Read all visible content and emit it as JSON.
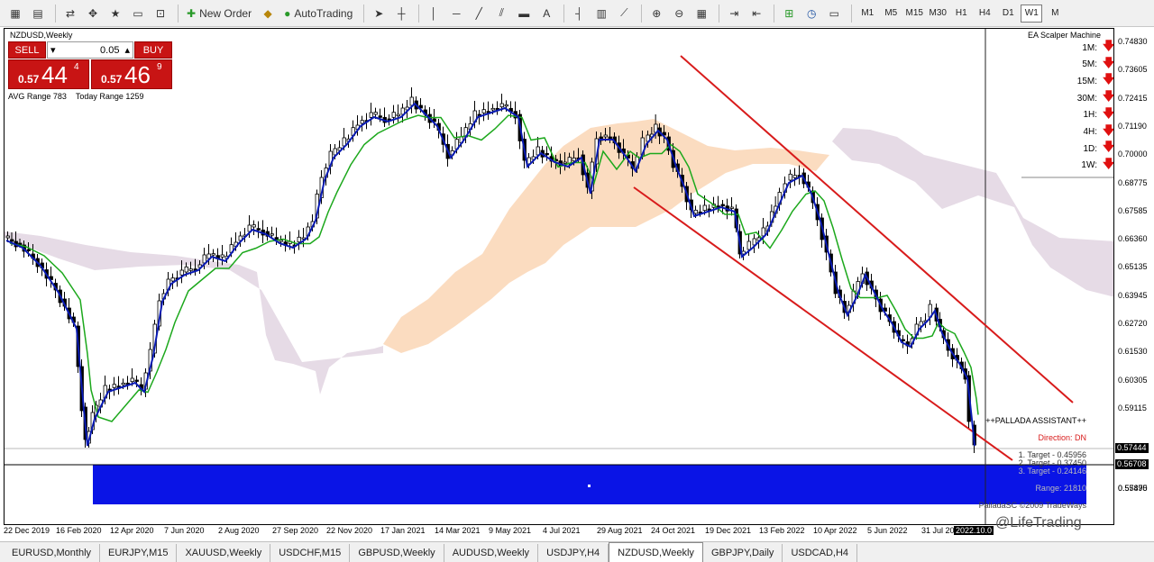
{
  "toolbar": {
    "new_order_label": "New Order",
    "autotrading_label": "AutoTrading",
    "timeframes": [
      "M1",
      "M5",
      "M15",
      "M30",
      "H1",
      "H4",
      "D1",
      "W1",
      "M"
    ],
    "active_timeframe": "W1"
  },
  "chart": {
    "symbol_title": "NZDUSD,Weekly",
    "trade_panel": {
      "sell_label": "SELL",
      "buy_label": "BUY",
      "lot": "0.05",
      "sell_pre": "0.57",
      "sell_big": "44",
      "sell_sup": "4",
      "buy_pre": "0.57",
      "buy_big": "46",
      "buy_sup": "9"
    },
    "avg_range": "AVG Range 783",
    "today_range": "Today Range 1259",
    "ea": {
      "title": "EA Scalper Machine",
      "rows": [
        "1M:",
        "5M:",
        "15M:",
        "30M:",
        "1H:",
        "4H:",
        "1D:",
        "1W:"
      ],
      "arrow": "🡇"
    },
    "pallada": {
      "title": "++PALLADA ASSISTANT++",
      "direction": "Direction: DN",
      "target1": "1. Target - 0.45956",
      "target2": "2. Target - 0.37450",
      "target3": "3. Target - 0.24146",
      "range": "Range: 21810",
      "copyright": "PalladaSC ©2009 TradeWays"
    },
    "watermark": "@LifeTrading",
    "price_labels": [
      "0.74830",
      "0.73605",
      "0.72415",
      "0.71190",
      "0.70000",
      "0.68775",
      "0.67585",
      "0.66360",
      "0.65135",
      "0.63945",
      "0.62720",
      "0.61530",
      "0.60305",
      "0.59115",
      "0.57890",
      "0.55475"
    ],
    "price_tag_current": "0.57444",
    "price_tag_level": "0.56708",
    "time_labels": [
      "22 Dec 2019",
      "16 Feb 2020",
      "12 Apr 2020",
      "7 Jun 2020",
      "2 Aug 2020",
      "27 Sep 2020",
      "22 Nov 2020",
      "17 Jan 2021",
      "14 Mar 2021",
      "9 May 2021",
      "4 Jul 2021",
      "29 Aug 2021",
      "24 Oct 2021",
      "19 Dec 2021",
      "13 Feb 2022",
      "10 Apr 2022",
      "5 Jun 2022",
      "31 Jul 2022",
      "2022.10.0"
    ]
  },
  "tabs": [
    "EURUSD,Monthly",
    "EURJPY,M15",
    "XAUUSD,Weekly",
    "USDCHF,M15",
    "GBPUSD,Weekly",
    "AUDUSD,Weekly",
    "USDJPY,H4",
    "NZDUSD,Weekly",
    "GBPJPY,Daily",
    "USDCAD,H4"
  ],
  "active_tab": "NZDUSD,Weekly",
  "colors": {
    "sell_buy": "#c81414",
    "channel": "#d81b1b",
    "blue_zone": "#0a14e6",
    "cloud_bull": "#fbdcc0",
    "cloud_bear": "#e6dbe6",
    "ema_fast": "#0a1bb4",
    "ema_slow": "#1ca81c"
  }
}
